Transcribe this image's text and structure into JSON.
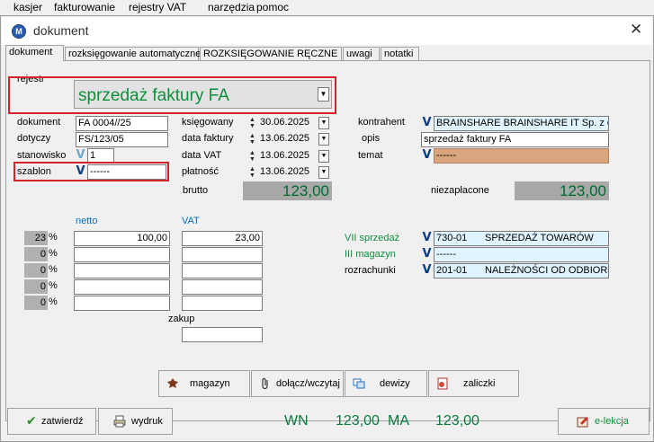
{
  "menu": [
    "kasjer",
    "fakturowanie",
    "rejestry VAT",
    "narzędzia",
    "pomoc"
  ],
  "window": {
    "title": "dokument",
    "close": "✕"
  },
  "tabs": [
    "dokument",
    "rozksięgowanie automatyczne",
    "ROZKSIĘGOWANIE RĘCZNE",
    "uwagi",
    "notatki"
  ],
  "rejestr": {
    "label": "rejestr",
    "value": "sprzedaż faktury FA"
  },
  "left": {
    "dokument_label": "dokument",
    "dokument_value": "FA 0004//25",
    "dotyczy_label": "dotyczy",
    "dotyczy_value": "FS/123/05",
    "stanowisko_label": "stanowisko",
    "stanowisko_value": "1",
    "szablon_label": "szablon",
    "szablon_value": "------"
  },
  "dates": {
    "ksiegowany_label": "księgowany",
    "ksiegowany": "30.06.2025",
    "data_faktury_label": "data faktury",
    "data_faktury": "13.06.2025",
    "data_vat_label": "data VAT",
    "data_vat": "13.06.2025",
    "platnosc_label": "płatność",
    "platnosc": "13.06.2025"
  },
  "right": {
    "kontrahent_label": "kontrahent",
    "kontrahent_value": "BRAINSHARE BRAINSHARE IT Sp. z o",
    "opis_label": "opis",
    "opis_value": "sprzedaż faktury FA",
    "temat_label": "temat",
    "temat_value": "------"
  },
  "totals": {
    "brutto_label": "brutto",
    "brutto": "123,00",
    "niezaplacone_label": "niezapłacone",
    "niezaplacone": "123,00"
  },
  "vat_table": {
    "netto_header": "netto",
    "vat_header": "VAT",
    "percent_sign": "%",
    "rows": [
      {
        "rate": "23",
        "netto": "100,00",
        "vat": "23,00"
      },
      {
        "rate": "0",
        "netto": "",
        "vat": ""
      },
      {
        "rate": "0",
        "netto": "",
        "vat": ""
      },
      {
        "rate": "0",
        "netto": "",
        "vat": ""
      },
      {
        "rate": "0",
        "netto": "",
        "vat": ""
      }
    ],
    "zakup_label": "zakup"
  },
  "accounts": {
    "sprzedaz_label": "VII sprzedaż",
    "sprzedaz_code": "730-01",
    "sprzedaz_name": "SPRZEDAŻ TOWARÓW",
    "magazyn_label": "III magazyn",
    "magazyn_value": "------",
    "rozrachunki_label": "rozrachunki",
    "rozrachunki_code": "201-01",
    "rozrachunki_name": "NALEŻNOŚCI OD ODBIORC"
  },
  "buttons": {
    "magazyn": "magazyn",
    "dolacz": "dołącz/wczytaj",
    "dewizy": "dewizy",
    "zaliczki": "zaliczki"
  },
  "footer": {
    "zatwierdz": "zatwierdź",
    "wydruk": "wydruk",
    "wn_label": "WN",
    "wn_value": "123,00",
    "ma_label": "MA",
    "ma_value": "123,00",
    "elekcja": "e-lekcja"
  },
  "colors": {
    "highlight_red": "#d2232a",
    "field_cyan": "#dff4ff",
    "field_tan": "#d8a57e",
    "total_grey": "#a8a8a8",
    "green_text": "#0d8f3c"
  }
}
